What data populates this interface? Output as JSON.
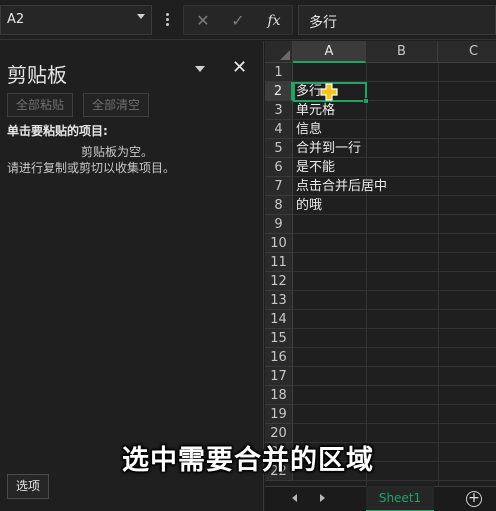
{
  "formula_bar": {
    "name_box": "A2",
    "fx_label": "fx",
    "formula_value": "多行",
    "cancel_glyph": "✕",
    "enter_glyph": "✓"
  },
  "clipboard_pane": {
    "title": "剪贴板",
    "close_glyph": "✕",
    "paste_all": "全部粘贴",
    "clear_all": "全部清空",
    "subtitle": "单击要粘贴的项目:",
    "empty_line1": "剪贴板为空。",
    "empty_line2": "请进行复制或剪切以收集项目。",
    "options": "选项"
  },
  "grid": {
    "columns": [
      "A",
      "B",
      "C"
    ],
    "rows": [
      "1",
      "2",
      "3",
      "4",
      "5",
      "6",
      "7",
      "8",
      "9",
      "10",
      "11",
      "12",
      "13",
      "14",
      "15",
      "16",
      "17",
      "18",
      "19",
      "20",
      "21",
      "22"
    ],
    "cells": [
      "",
      "多行",
      "单元格",
      "信息",
      "合并到一行",
      "是不能",
      "点击合并后居中",
      "的哦"
    ],
    "active_cell": "A2"
  },
  "sheet_tabs": {
    "sheet1": "Sheet1",
    "add_glyph": "+"
  },
  "caption": "选中需要合并的区域",
  "colors": {
    "accent": "#21a366",
    "background": "#1f1f1f",
    "header": "#2a2a2a"
  }
}
